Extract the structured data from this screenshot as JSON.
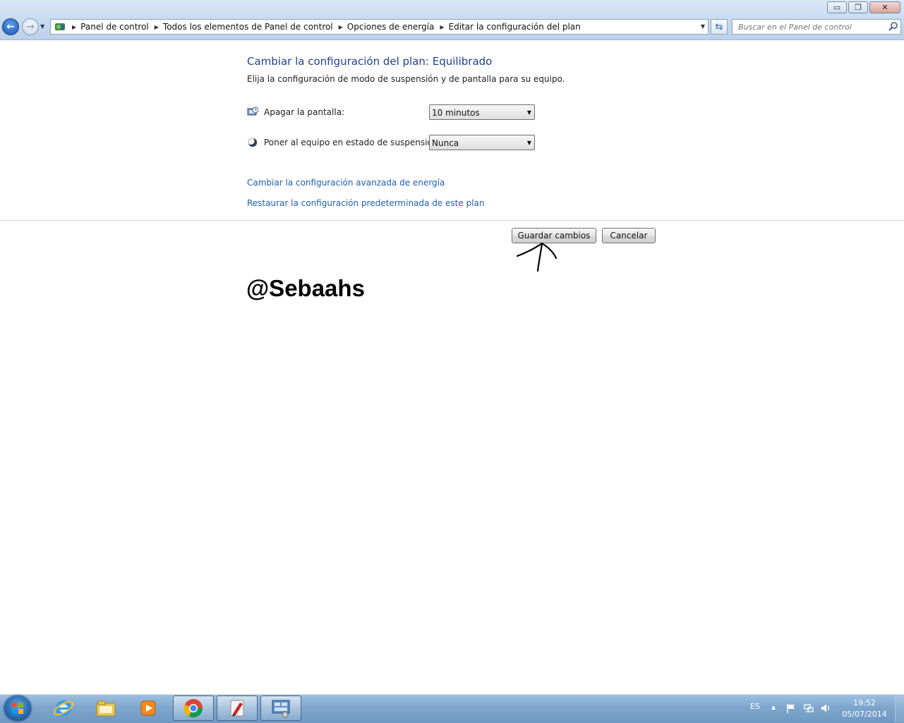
{
  "window": {
    "minimize_label": "▭",
    "restore_label": "❐",
    "close_label": "✕"
  },
  "address": {
    "breadcrumbs": [
      "Panel de control",
      "Todos los elementos de Panel de control",
      "Opciones de energía",
      "Editar la configuración del plan"
    ]
  },
  "search": {
    "placeholder": "Buscar en el Panel de control"
  },
  "content": {
    "title": "Cambiar la configuración del plan: Equilibrado",
    "subtitle": "Elija la configuración de modo de suspensión y de pantalla para su equipo.",
    "display_off_label": "Apagar la pantalla:",
    "display_off_value": "10 minutos",
    "sleep_label": "Poner al equipo en estado de suspensión:",
    "sleep_value": "Nunca",
    "advanced_link": "Cambiar la configuración avanzada de energía",
    "restore_link": "Restaurar la configuración predeterminada de este plan",
    "save_button": "Guardar cambios",
    "cancel_button": "Cancelar",
    "watermark": "@Sebaahs"
  },
  "taskbar": {
    "language": "ES",
    "time": "19:52",
    "date": "05/07/2014",
    "icons": [
      "internet-explorer-icon",
      "file-explorer-icon",
      "media-player-icon",
      "chrome-icon",
      "paint-app-icon",
      "control-panel-icon"
    ]
  }
}
